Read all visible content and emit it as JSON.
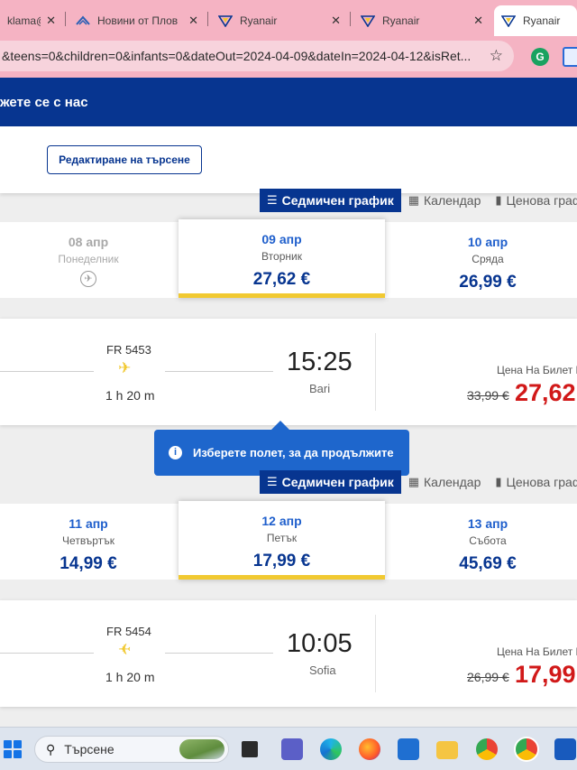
{
  "browser": {
    "tabs": [
      {
        "title": "klama@",
        "favicon": "mail-icon"
      },
      {
        "title": "Новини от Плов",
        "favicon": "news-icon"
      },
      {
        "title": "Ryanair",
        "favicon": "ryanair-icon"
      },
      {
        "title": "Ryanair",
        "favicon": "ryanair-icon"
      },
      {
        "title": "Ryanair",
        "favicon": "ryanair-icon"
      }
    ],
    "url": "&teens=0&children=0&infants=0&dateOut=2024-04-09&dateIn=2024-04-12&isRet..."
  },
  "header": {
    "contact_label": "жете се с нас"
  },
  "search": {
    "edit_label": "Редактиране на търсене"
  },
  "view_switcher": {
    "weekly": "Седмичен график",
    "calendar": "Календар",
    "price_chart": "Ценова граф"
  },
  "outbound": {
    "dates": [
      {
        "date": "08 апр",
        "day": "Понеделник",
        "price": "",
        "disabled": true
      },
      {
        "date": "09 апр",
        "day": "Вторник",
        "price": "27,62 €",
        "selected": true
      },
      {
        "date": "10 апр",
        "day": "Сряда",
        "price": "26,99 €"
      }
    ],
    "flight": {
      "number": "FR 5453",
      "duration": "1 h 20 m",
      "arrival_time": "15:25",
      "arrival_city": "Bari",
      "price_label": "Цена На Билет Е",
      "old_price": "33,99 €",
      "new_price": "27,62"
    }
  },
  "tooltip": {
    "text": "Изберете полет, за да продължите"
  },
  "inbound": {
    "dates": [
      {
        "date": "11 апр",
        "day": "Четвъртък",
        "price": "14,99 €"
      },
      {
        "date": "12 апр",
        "day": "Петък",
        "price": "17,99 €",
        "selected": true
      },
      {
        "date": "13 апр",
        "day": "Събота",
        "price": "45,69 €"
      }
    ],
    "flight": {
      "number": "FR 5454",
      "duration": "1 h 20 m",
      "arrival_time": "10:05",
      "arrival_city": "Sofia",
      "price_label": "Цена На Билет Е",
      "old_price": "26,99 €",
      "new_price": "17,99"
    }
  },
  "taskbar": {
    "search_placeholder": "Търсене"
  },
  "colors": {
    "brand_blue": "#073590",
    "accent_yellow": "#f1c931",
    "price_red": "#d11919",
    "tab_strip": "#f5b3c3"
  }
}
